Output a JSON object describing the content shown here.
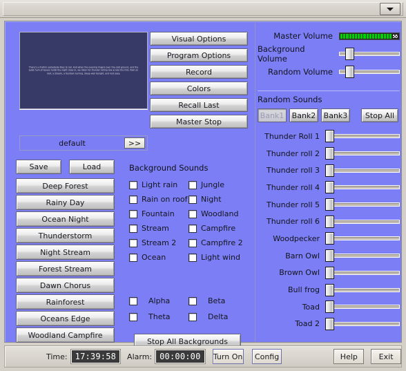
{
  "window": {
    "dropdown_icon": "chevron-down-icon"
  },
  "preview": {
    "text": "There's a rhythm somebody likes to roll. And when the evening lingers over the cold ground, and the quiet hum of leaves holds the night close in, we listen for thunder rolling low across the hills. Rain on roof, a stream, a fountain turning. Sleep well tonight, and rest easy.",
    "preset_name": "default",
    "next_button": ">>"
  },
  "options": {
    "buttons": [
      "Visual Options",
      "Program Options",
      "Record",
      "Colors",
      "Recall Last",
      "Master Stop"
    ]
  },
  "presets": {
    "save_label": "Save",
    "load_label": "Load",
    "items": [
      "Deep Forest",
      "Rainy Day",
      "Ocean Night",
      "Thunderstorm",
      "Night Stream",
      "Forest Stream",
      "Dawn Chorus",
      "Rainforest",
      "Oceans Edge",
      "Woodland Campfire"
    ]
  },
  "background_sounds": {
    "title": "Background Sounds",
    "items": [
      {
        "label": "Light rain",
        "checked": false
      },
      {
        "label": "Jungle",
        "checked": false
      },
      {
        "label": "Rain on roof",
        "checked": false
      },
      {
        "label": "Night",
        "checked": false
      },
      {
        "label": "Fountain",
        "checked": false
      },
      {
        "label": "Woodland",
        "checked": false
      },
      {
        "label": "Stream",
        "checked": false
      },
      {
        "label": "Campfire",
        "checked": false
      },
      {
        "label": "Stream 2",
        "checked": false
      },
      {
        "label": "Campfire 2",
        "checked": false
      },
      {
        "label": "Ocean",
        "checked": false
      },
      {
        "label": "Light wind",
        "checked": false
      }
    ],
    "waves": [
      {
        "label": "Alpha",
        "checked": false
      },
      {
        "label": "Beta",
        "checked": false
      },
      {
        "label": "Theta",
        "checked": false
      },
      {
        "label": "Delta",
        "checked": false
      }
    ],
    "stop_all_label": "Stop All Backgrounds"
  },
  "volumes": {
    "master": {
      "label": "Master Volume",
      "type": "meter",
      "segments": 18,
      "level": 100
    },
    "background": {
      "label": "Background Volume",
      "value": 12
    },
    "random": {
      "label": "Random Volume",
      "value": 12
    }
  },
  "random_sounds": {
    "title": "Random Sounds",
    "banks": [
      {
        "label": "Bank1",
        "active": true
      },
      {
        "label": "Bank2",
        "active": false
      },
      {
        "label": "Bank3",
        "active": false
      }
    ],
    "stop_all_label": "Stop All",
    "sliders": [
      {
        "label": "Thunder Roll 1",
        "value": 0
      },
      {
        "label": "Thunder roll 2",
        "value": 0
      },
      {
        "label": "Thunder roll 3",
        "value": 0
      },
      {
        "label": "Thunder roll 4",
        "value": 0
      },
      {
        "label": "Thunder roll 5",
        "value": 0
      },
      {
        "label": "Thunder roll 6",
        "value": 0
      },
      {
        "label": "Woodpecker",
        "value": 0
      },
      {
        "label": "Barn Owl",
        "value": 0
      },
      {
        "label": "Brown Owl",
        "value": 0
      },
      {
        "label": "Bull frog",
        "value": 0
      },
      {
        "label": "Toad",
        "value": 0
      },
      {
        "label": "Toad 2",
        "value": 0
      }
    ]
  },
  "statusbar": {
    "time_label": "Time:",
    "time_value": "17:39:58",
    "alarm_label": "Alarm:",
    "alarm_value": "00:00:00",
    "turn_on_label": "Turn On",
    "config_label": "Config",
    "help_label": "Help",
    "exit_label": "Exit"
  },
  "colors": {
    "panel": "#7b7ef5",
    "screen": "#373a66",
    "led": "#00d400",
    "chrome": "#d4d0c8"
  }
}
